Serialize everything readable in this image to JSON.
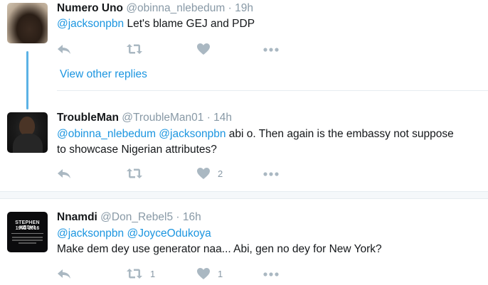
{
  "tweets": [
    {
      "name": "Numero Uno",
      "handle": "@obinna_nlebedum",
      "time": "· 19h",
      "mentions": "@jacksonpbn",
      "text": " Let's blame GEJ and PDP",
      "retweet_count": "",
      "like_count": ""
    },
    {
      "name": "TroubleMan",
      "handle": "@TroubleMan01",
      "time": "· 14h",
      "mentions": "@obinna_nlebedum @jacksonpbn",
      "text": " abi o. Then again is the embassy not suppose",
      "text2": "to showcase Nigerian attributes?",
      "retweet_count": "",
      "like_count": "2"
    },
    {
      "name": "Nnamdi",
      "handle": "@Don_Rebel5",
      "time": "· 16h",
      "mentions": "@jacksonpbn @JoyceOdukoya",
      "text": "Make dem dey use generator naa... Abi, gen no dey for New York?",
      "retweet_count": "1",
      "like_count": "1",
      "avatar_text_1": "STEPHEN KESHI",
      "avatar_text_2": "1962-2016"
    }
  ],
  "view_other_replies": "View other replies",
  "colors": {
    "accent": "#1b95e0",
    "meta": "#8899a6",
    "thread_line": "#5bb2e5"
  },
  "icons": [
    "reply-icon",
    "retweet-icon",
    "heart-icon",
    "more-icon"
  ]
}
